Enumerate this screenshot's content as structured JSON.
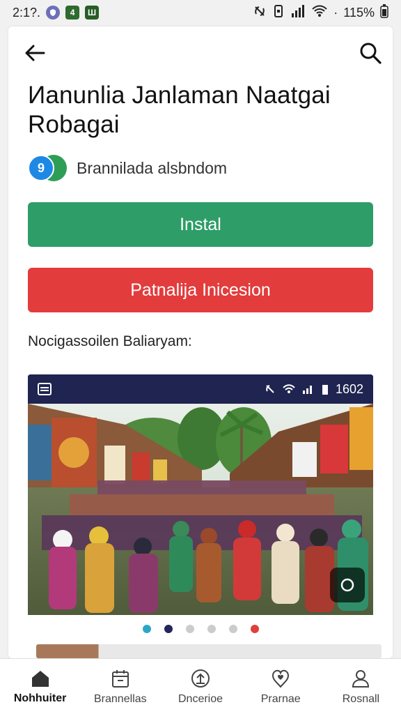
{
  "status_bar": {
    "time": "2:1?.",
    "badge_1": "4",
    "badge_2": "Ш",
    "battery": "115%",
    "dot": "·"
  },
  "app": {
    "title": "Иanunlia Janlaman Naatgai Robagai",
    "developer": "Brannilada alsbndom",
    "developer_logo_glyph": "9",
    "install_label": "Instal",
    "secondary_label": "Patnalija Inicesion",
    "screenshots_label": "Nocigassoilen Baliaryam:"
  },
  "screenshot": {
    "status_time": "1602",
    "pager": {
      "total": 6,
      "active_index": 1,
      "colors": [
        "#2aa7c7",
        "#23265a",
        "#cccccc",
        "#cccccc",
        "#cccccc",
        "#e0403a"
      ]
    }
  },
  "bottom_nav": [
    {
      "label": "Nohhuiter",
      "icon": "home-icon",
      "active": true
    },
    {
      "label": "Brannellas",
      "icon": "calendar-icon",
      "active": false
    },
    {
      "label": "Dncerioe",
      "icon": "upload-icon",
      "active": false
    },
    {
      "label": "Prarnae",
      "icon": "heart-location-icon",
      "active": false
    },
    {
      "label": "Rosnall",
      "icon": "person-icon",
      "active": false
    }
  ],
  "colors": {
    "install": "#2e9d68",
    "secondary": "#e23c3c",
    "shot_status": "#1f2450"
  }
}
